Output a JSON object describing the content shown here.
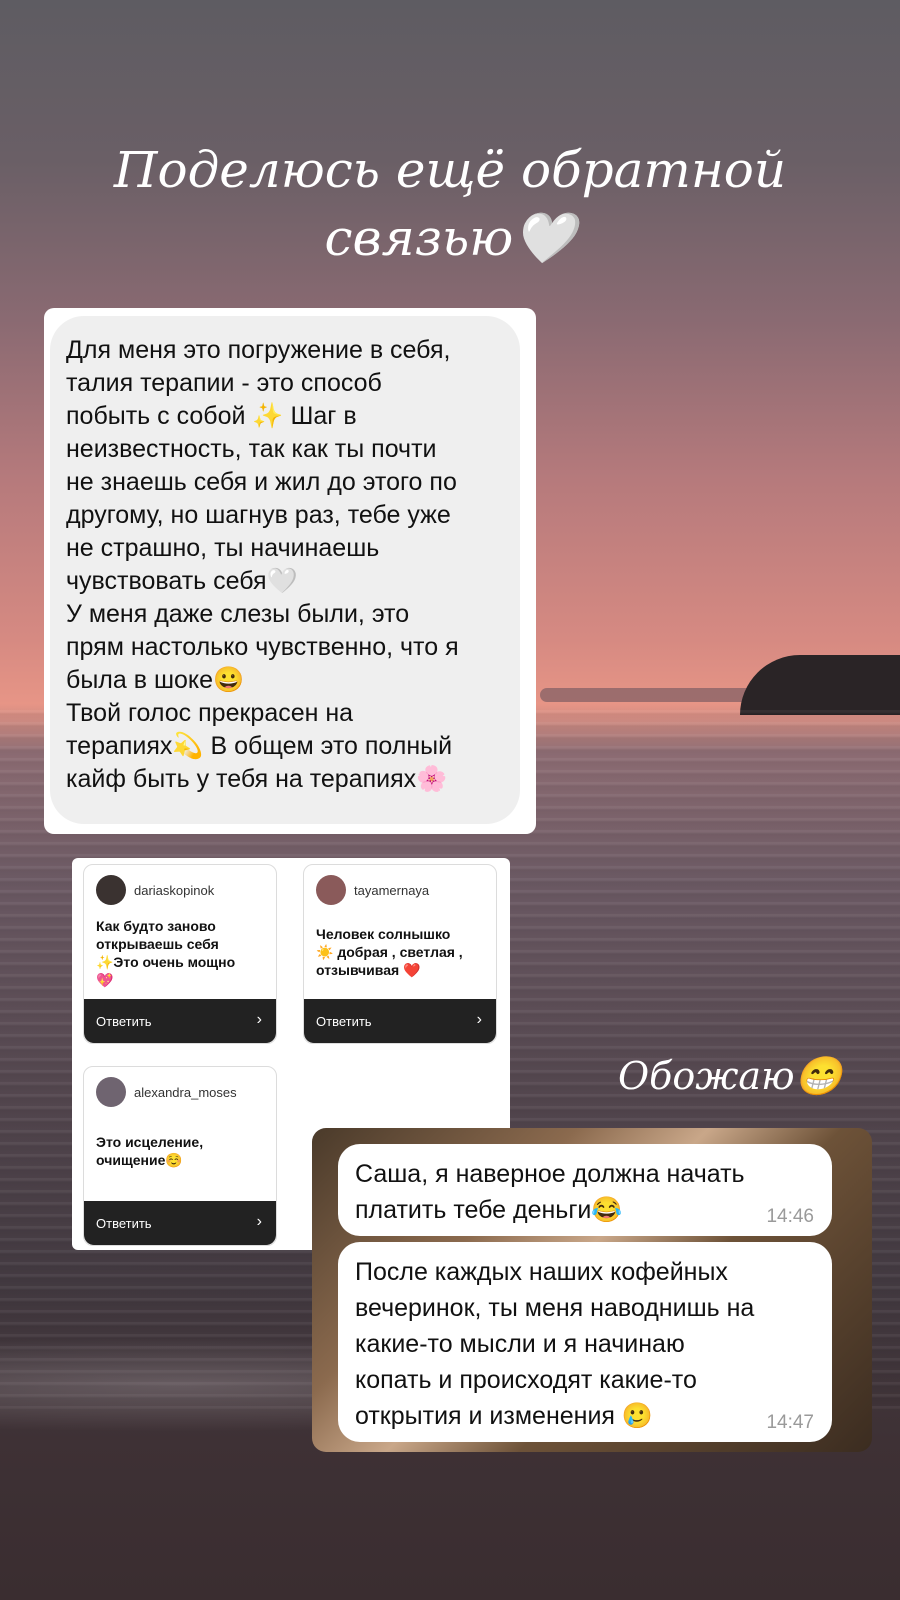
{
  "headline": "Поделюсь ещё обратной\nсвязью🤍",
  "feedback_message": "Для меня это погружение в себя,\nталия терапии - это способ\nпобыть с собой ✨ Шаг в\nнеизвестность, так как ты почти\nне знаешь себя и жил до этого по\nдругому, но шагнув раз, тебе уже\nне страшно, ты начинаешь\nчувствовать себя🤍\nУ меня даже слезы были, это\nпрям настолько чувственно, что я\nбыла в шоке😀\nТвой голос прекрасен на\nтерапиях💫 В общем это полный\nкайф быть у тебя на терапиях🌸",
  "questions": [
    {
      "username": "dariaskopinok",
      "text": "Как будто заново\nоткрываешь себя\n✨Это очень мощно\n💖",
      "reply_label": "Ответить",
      "chevron": "›"
    },
    {
      "username": "tayamernaya",
      "text": "Человек солнышко\n☀️ добрая , светлая ,\nотзывчивая ❤️",
      "reply_label": "Ответить",
      "chevron": "›"
    },
    {
      "username": "alexandra_moses",
      "text": "Это исцеление,\nочищение☺️",
      "reply_label": "Ответить",
      "chevron": "›"
    }
  ],
  "caption": "Обожаю😁",
  "chat": [
    {
      "text": "Саша, я наверное должна начать\nплатить тебе деньги😂",
      "time": "14:46"
    },
    {
      "text": "После каждых наших кофейных\nвечеринок, ты меня наводнишь на\nкакие-то мысли и я начинаю\nкопать и происходят какие-то\nоткрытия и изменения 🥲",
      "time": "14:47"
    }
  ],
  "icons": {
    "avatar": "avatar",
    "chevron": "chevron-right-icon"
  }
}
